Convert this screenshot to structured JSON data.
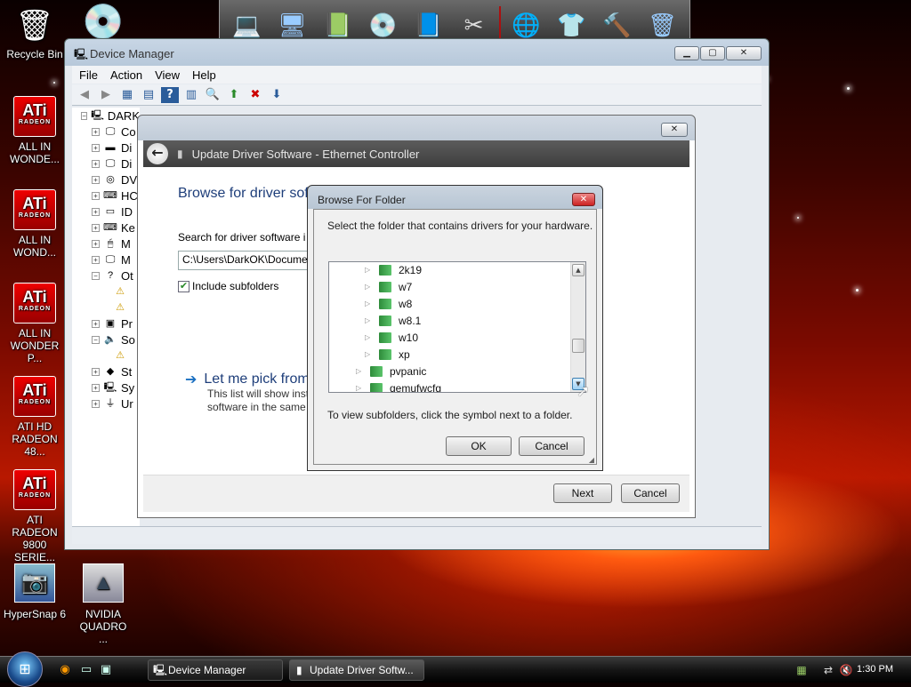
{
  "desktop": {
    "icons": [
      {
        "label": "Recycle Bin",
        "icon": "recycle-bin-icon"
      },
      {
        "label": "ALL IN WONDE...",
        "icon": "ati-icon"
      },
      {
        "label": "ALL IN WOND...",
        "icon": "ati-icon"
      },
      {
        "label": "ALL IN WONDER P...",
        "icon": "ati-icon"
      },
      {
        "label": "ATI HD RADEON 48...",
        "icon": "ati-icon"
      },
      {
        "label": "ATI RADEON 9800 SERIE...",
        "icon": "ati-icon"
      },
      {
        "label": "HyperSnap 6",
        "icon": "hypersnap-icon"
      },
      {
        "label": "NVIDIA QUADRO ...",
        "icon": "nvidia-icon"
      }
    ],
    "ati_logo": "ATi",
    "ati_sub": "RADEON"
  },
  "device_manager": {
    "title": "Device Manager",
    "menu": [
      "File",
      "Action",
      "View",
      "Help"
    ],
    "tree": [
      {
        "exp": "-",
        "label": "DARK",
        "icon": "computer-icon"
      },
      {
        "exp": "+",
        "label": "Co",
        "icon": "monitor-icon"
      },
      {
        "exp": "+",
        "label": "Di",
        "icon": "drive-icon"
      },
      {
        "exp": "+",
        "label": "Di",
        "icon": "display-icon"
      },
      {
        "exp": "+",
        "label": "DV",
        "icon": "dvd-icon"
      },
      {
        "exp": "+",
        "label": "HC",
        "icon": "hid-icon"
      },
      {
        "exp": "+",
        "label": "ID",
        "icon": "ide-icon"
      },
      {
        "exp": "+",
        "label": "Ke",
        "icon": "keyboard-icon"
      },
      {
        "exp": "+",
        "label": "M",
        "icon": "mouse-icon"
      },
      {
        "exp": "+",
        "label": "M",
        "icon": "monitor-icon"
      },
      {
        "exp": "-",
        "label": "Ot",
        "icon": "other-devices-icon"
      },
      {
        "exp": "",
        "label": "",
        "icon": "warning-device-icon"
      },
      {
        "exp": "",
        "label": "",
        "icon": "warning-device-icon"
      },
      {
        "exp": "+",
        "label": "Pr",
        "icon": "processor-icon"
      },
      {
        "exp": "-",
        "label": "So",
        "icon": "sound-icon"
      },
      {
        "exp": "",
        "label": "",
        "icon": "warning-device-icon"
      },
      {
        "exp": "+",
        "label": "St",
        "icon": "storage-icon"
      },
      {
        "exp": "+",
        "label": "Sy",
        "icon": "system-icon"
      },
      {
        "exp": "+",
        "label": "Ur",
        "icon": "usb-icon"
      }
    ]
  },
  "update_driver": {
    "title": "Update Driver Software - Ethernet Controller",
    "heading": "Browse for driver sof",
    "search_label": "Search for driver software i",
    "path_value": "C:\\Users\\DarkOK\\Docume",
    "include_subfolders": "Include subfolders",
    "pick_link": "Let me pick from",
    "pick_desc_1": "This list will show inst",
    "pick_desc_2": "software in the same",
    "next_button": "Next",
    "cancel_button": "Cancel"
  },
  "browse_folder": {
    "title": "Browse For Folder",
    "instruction": "Select the folder that contains drivers for your hardware.",
    "folders": [
      {
        "label": "2k19",
        "level": 1
      },
      {
        "label": "w7",
        "level": 1
      },
      {
        "label": "w8",
        "level": 1
      },
      {
        "label": "w8.1",
        "level": 1
      },
      {
        "label": "w10",
        "level": 1
      },
      {
        "label": "xp",
        "level": 1
      },
      {
        "label": "pvpanic",
        "level": 0
      },
      {
        "label": "qemufwcfg",
        "level": 0
      }
    ],
    "hint": "To view subfolders, click the symbol next to a folder.",
    "ok_button": "OK",
    "cancel_button": "Cancel"
  },
  "taskbar": {
    "tasks": [
      "Device Manager",
      "Update Driver Softw..."
    ],
    "clock": "1:30 PM"
  }
}
